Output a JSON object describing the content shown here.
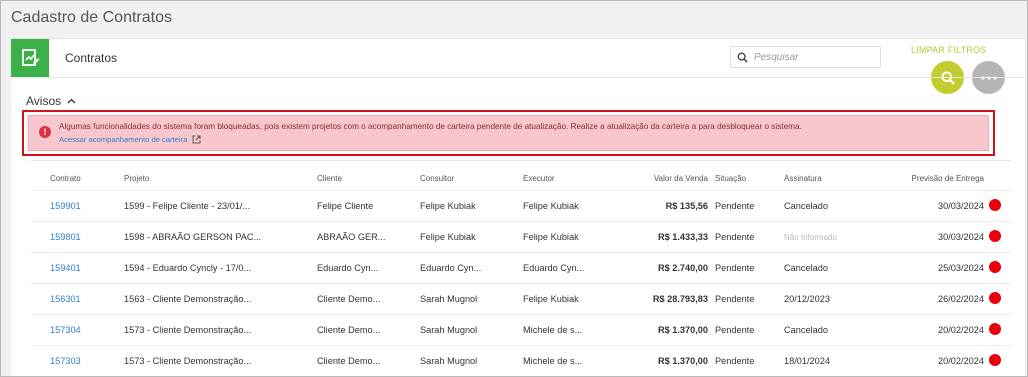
{
  "page": {
    "title": "Cadastro de Contratos"
  },
  "module": {
    "title": "Contratos",
    "icon": "contract-edit-icon"
  },
  "toolbar": {
    "search_placeholder": "Pesquisar",
    "search_value": "",
    "clear_filters": "LIMPAR FILTROS",
    "search_button_icon": "search-icon",
    "more_button_icon": "more-options-icon"
  },
  "alerts": {
    "title": "Avisos",
    "message": "Algumas funcionalidades do sistema foram bloqueadas, pois existem projetos com o acompanhamento de carteira pendente de atualização. Realize a atualização da carteira a para desbloquear o sistema.",
    "link": "Acessar acompanhamento de carteira"
  },
  "table": {
    "columns": {
      "contrato": "Contrato",
      "projeto": "Projeto",
      "cliente": "Cliente",
      "consultor": "Consultor",
      "executor": "Executor",
      "valor": "Valor da Venda",
      "situacao": "Situação",
      "assinatura": "Assinatura",
      "previsao": "Previsão de Entrega"
    },
    "rows": [
      {
        "contrato": "159901",
        "projeto": "1599 - Felipe Cliente - 23/01/...",
        "cliente": "Felipe Cliente",
        "consultor": "Felipe Kubiak",
        "executor": "Felipe Kubiak",
        "valor": "R$ 135,56",
        "situacao": "Pendente",
        "assinatura": "Cancelado",
        "previsao": "30/03/2024"
      },
      {
        "contrato": "159801",
        "projeto": "1598 - ABRAÃO GERSON PAC...",
        "cliente": "ABRAÃO GER...",
        "consultor": "Felipe Kubiak",
        "executor": "Felipe Kubiak",
        "valor": "R$ 1.433,33",
        "situacao": "Pendente",
        "assinatura": "Não Informado",
        "previsao": "30/03/2024"
      },
      {
        "contrato": "159401",
        "projeto": "1594 - Eduardo Cyncly - 17/0...",
        "cliente": "Eduardo Cyn...",
        "consultor": "Eduardo Cyn...",
        "executor": "Eduardo Cyn...",
        "valor": "R$ 2.740,00",
        "situacao": "Pendente",
        "assinatura": "Cancelado",
        "previsao": "25/03/2024"
      },
      {
        "contrato": "156301",
        "projeto": "1563 - Cliente Demonstração...",
        "cliente": "Cliente Demo...",
        "consultor": "Sarah Mugnol",
        "executor": "Felipe Kubiak",
        "valor": "R$ 28.793,83",
        "situacao": "Pendente",
        "assinatura": "20/12/2023",
        "previsao": "26/02/2024"
      },
      {
        "contrato": "157304",
        "projeto": "1573 - Cliente Demonstração...",
        "cliente": "Cliente Demo...",
        "consultor": "Sarah Mugnol",
        "executor": "Michele de s...",
        "valor": "R$ 1.370,00",
        "situacao": "Pendente",
        "assinatura": "Cancelado",
        "previsao": "20/02/2024"
      },
      {
        "contrato": "157303",
        "projeto": "1573 - Cliente Demonstração...",
        "cliente": "Cliente Demo...",
        "consultor": "Sarah Mugnol",
        "executor": "Michele de s...",
        "valor": "R$ 1.370,00",
        "situacao": "Pendente",
        "assinatura": "18/01/2024",
        "previsao": "20/02/2024"
      }
    ]
  },
  "colors": {
    "accent_green": "#3cb04a",
    "accent_lime": "#c2cd2f",
    "alert_red": "#d0121b",
    "link_blue": "#2f7fd0",
    "status_red": "#e8000b"
  }
}
